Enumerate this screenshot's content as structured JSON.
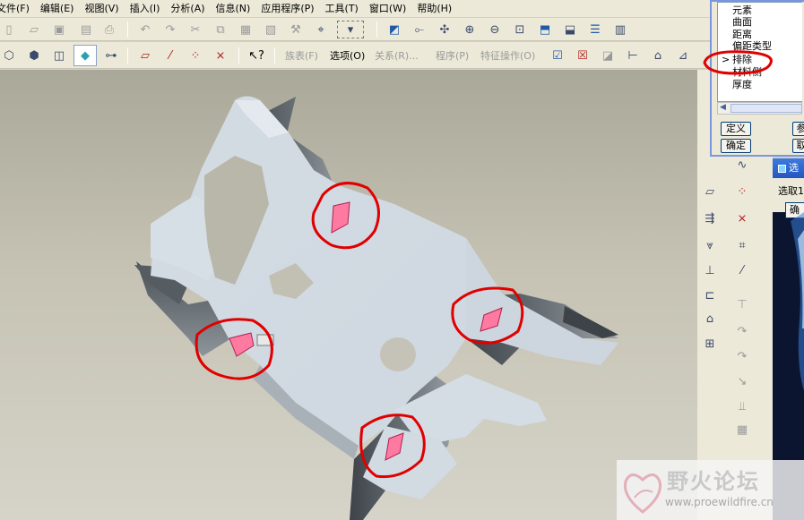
{
  "menubar": {
    "items": [
      "文件(F)",
      "编辑(E)",
      "视图(V)",
      "插入(I)",
      "分析(A)",
      "信息(N)",
      "应用程序(P)",
      "工具(T)",
      "窗口(W)",
      "帮助(H)"
    ]
  },
  "toolbar2": {
    "family_table": "族表(F)",
    "options": "选项(O)",
    "relations": "关系(R)...",
    "program": "程序(P)",
    "feature_ops": "特征操作(O)"
  },
  "shell_dialog": {
    "list_items": [
      "元素",
      "曲面",
      "距离",
      "偏距类型",
      "排除",
      "材料侧",
      "厚度"
    ],
    "selected_marker": ">",
    "define_button": "定义",
    "ok_button": "确定",
    "ref_button": "参",
    "cancel_button": "取"
  },
  "select_dialog": {
    "title": "选",
    "prompt": "选取1",
    "ok_button": "确"
  },
  "watermark": {
    "title": "野火论坛",
    "url": "www.proewildfire.cn"
  },
  "colors": {
    "annotation_red": "#e00000",
    "model_face": "#d5dde4",
    "model_dark": "#555c62",
    "highlight_pink": "#ff5a8a",
    "viewport_top": "#aaa899",
    "viewport_bottom": "#d6d4c9"
  },
  "icons": {
    "toolbar1": [
      "new-file-icon",
      "open-folder-icon",
      "save-icon",
      "save-copy-icon",
      "print-icon",
      "undo-icon",
      "redo-icon",
      "cut-icon",
      "copy-icon",
      "paste-icon",
      "paste-special-icon",
      "regenerate-icon",
      "find-icon",
      "select-box-icon",
      "repaint-icon",
      "spin-center-icon",
      "orient-icon",
      "zoom-in-icon",
      "zoom-out-icon",
      "refit-icon",
      "reorient-icon",
      "saved-views-icon",
      "layers-icon",
      "view-manager-icon"
    ],
    "toolbar2": [
      "wireframe-icon",
      "hidden-line-icon",
      "no-hidden-icon",
      "shading-icon",
      "model-tree-icon",
      "datum-planes-icon",
      "datum-axes-icon",
      "datum-points-icon",
      "coord-sys-icon",
      "whats-this-icon",
      "feature-ok-icon",
      "feature-cancel-icon",
      "tag-icon",
      "dimension-icon",
      "section-icon",
      "draft-icon"
    ]
  }
}
